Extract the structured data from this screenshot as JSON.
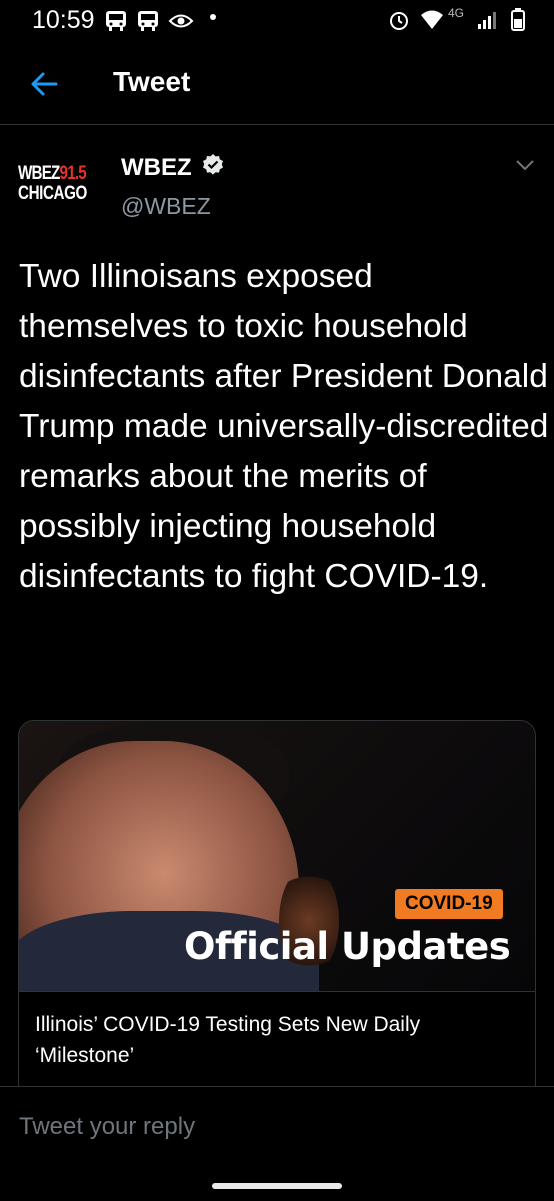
{
  "status": {
    "time": "10:59",
    "network": "4G"
  },
  "header": {
    "title": "Tweet"
  },
  "tweet": {
    "logo_line1_a": "WBEZ",
    "logo_line1_b": "91.5",
    "logo_line2": "CHICAGO",
    "author_name": "WBEZ",
    "author_handle": "@WBEZ",
    "text": "Two Illinoisans exposed themselves to toxic household disinfectants  after President Donald Trump made universally-discredited remarks about the merits of possibly injecting household disinfectants to fight COVID-19."
  },
  "card": {
    "badge": "COVID-19",
    "overlay_title": "Official Updates",
    "title": "Illinois’ COVID-19 Testing Sets New Daily ‘Milestone’"
  },
  "reply": {
    "placeholder": "Tweet your reply"
  },
  "colors": {
    "accent": "#1d9bf0",
    "badge": "#f07b22",
    "logo_red": "#e5332a",
    "background": "#000000"
  }
}
